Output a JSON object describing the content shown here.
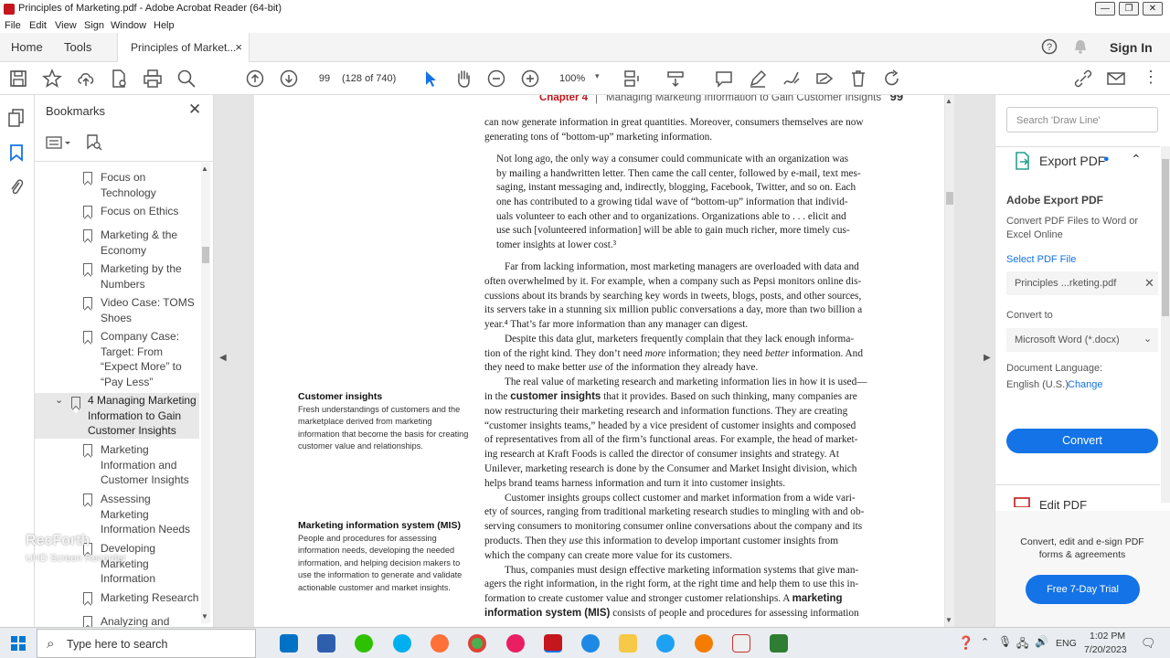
{
  "window": {
    "title": "Principles of Marketing.pdf - Adobe Acrobat Reader (64-bit)",
    "controls": [
      "—",
      "❐",
      "✕"
    ]
  },
  "menu": [
    "File",
    "Edit",
    "View",
    "Sign",
    "Window",
    "Help"
  ],
  "tabs": {
    "home": "Home",
    "tools": "Tools",
    "document": "Principles of Market...",
    "close": "×",
    "sign_in": "Sign In"
  },
  "toolbar": {
    "page_number": "99",
    "page_count": "(128 of 740)",
    "zoom": "100%"
  },
  "bookmarks": {
    "title": "Bookmarks",
    "items": [
      {
        "label": "Focus on Technology",
        "lines": [
          "Focus on",
          "Technology"
        ]
      },
      {
        "label": "Focus on Ethics",
        "lines": [
          "Focus on Ethics"
        ]
      },
      {
        "label": "Marketing & the Economy",
        "lines": [
          "Marketing & the",
          "Economy"
        ]
      },
      {
        "label": "Marketing by the Numbers",
        "lines": [
          "Marketing by the",
          "Numbers"
        ]
      },
      {
        "label": "Video Case: TOMS Shoes",
        "lines": [
          "Video Case: TOMS",
          "Shoes"
        ]
      },
      {
        "label": "Company Case: Target: From “Expect More” to “Pay Less”",
        "lines": [
          "Company Case:",
          "Target: From",
          "“Expect More” to",
          "“Pay Less”"
        ]
      }
    ],
    "chapter": {
      "lines": [
        "4 Managing Marketing",
        "Information to Gain",
        "Customer Insights"
      ]
    },
    "subitems": [
      {
        "lines": [
          "Marketing",
          "Information and",
          "Customer Insights"
        ]
      },
      {
        "lines": [
          "Assessing",
          "Marketing",
          "Information Needs"
        ]
      },
      {
        "lines": [
          "Developing",
          "Marketing",
          "Information"
        ]
      },
      {
        "lines": [
          "Marketing Research"
        ]
      },
      {
        "lines": [
          "Analyzing and"
        ]
      }
    ]
  },
  "page": {
    "header_chapter": "Chapter 4",
    "header_title": "Managing Marketing Information to Gain Customer Insights",
    "header_page": "99",
    "lines": [
      "can now generate information in great quantities. Moreover, consumers themselves are now",
      "generating tons of “bottom-up” marketing information.",
      "Not long ago, the only way a consumer could communicate with an organization was",
      "by mailing a handwritten letter. Then came the call center, followed by e-mail, text mes-",
      "saging, instant messaging and, indirectly, blogging, Facebook, Twitter, and so on. Each",
      "one has contributed to a growing tidal wave of “bottom-up” information that individ-",
      "uals volunteer to each other and to organizations. Organizations able to . . . elicit and",
      "use such [volunteered information] will be able to gain much richer, more timely cus-",
      "tomer insights at lower cost.³",
      "Far from lacking information, most marketing managers are overloaded with data and",
      "often overwhelmed by it. For example, when a company such as Pepsi monitors online dis-",
      "cussions about its brands by searching key words in tweets, blogs, posts, and other sources,",
      "its servers take in a stunning six million public conversations a day, more than two billion a",
      "year.⁴ That’s far more information than any manager can digest.",
      "Despite this data glut, marketers frequently complain that they lack enough informa-",
      "tion of the right kind. They don’t need more information; they need better information. And",
      "they need to make better use of the information they already have.",
      "The real value of marketing research and marketing information lies in how it is used—",
      "in the customer insights that it provides. Based on such thinking, many companies are",
      "now restructuring their marketing research and information functions. They are creating",
      "“customer insights teams,” headed by a vice president of customer insights and composed",
      "of representatives from all of the firm’s functional areas. For example, the head of market-",
      "ing research at Kraft Foods is called the director of consumer insights and strategy. At",
      "Unilever, marketing research is done by the Consumer and Market Insight division, which",
      "helps brand teams harness information and turn it into customer insights.",
      "Customer insights groups collect customer and market information from a wide vari-",
      "ety of sources, ranging from traditional marketing research studies to mingling with and ob-",
      "serving consumers to monitoring consumer online conversations about the company and its",
      "products. Then they use this information to develop important customer insights from",
      "which the company can create more value for its customers.",
      "Thus, companies must design effective marketing information systems that give man-",
      "agers the right information, in the right form, at the right time and help them to use this in-",
      "formation to create customer value and stronger customer relationships. A marketing",
      "information system (MIS) consists of people and procedures for assessing information"
    ],
    "sidebar1_title": "Customer insights",
    "sidebar1_text": "Fresh understandings of customers and the marketplace derived from marketing information that become the basis for creating customer value and relationships.",
    "sidebar2_title": "Marketing information system (MIS)",
    "sidebar2_text": "People and procedures for assessing information needs, developing the needed information, and helping decision makers to use the information to generate and validate actionable customer and market insights."
  },
  "right_panel": {
    "search_placeholder": "Search 'Draw Line'",
    "export_title": "Export PDF",
    "adobe_export": "Adobe Export PDF",
    "convert_desc": "Convert PDF Files to Word or Excel Online",
    "select_file": "Select PDF File",
    "file_name": "Principles ...rketing.pdf",
    "convert_to": "Convert to",
    "format": "Microsoft Word (*.docx)",
    "doc_language_label": "Document Language:",
    "doc_language": "English (U.S.)",
    "change": "Change",
    "convert_button": "Convert",
    "edit_pdf": "Edit PDF",
    "promo": "Convert, edit and e-sign PDF forms & agreements",
    "trial_button": "Free 7-Day Trial"
  },
  "taskbar": {
    "search_placeholder": "Type here to search",
    "lang": "ENG",
    "time": "1:02 PM",
    "date": "7/20/2023"
  },
  "watermark": {
    "line1": "RecForth",
    "line2": "UHD Screen Recorder"
  },
  "colors": {
    "accent": "#1473e6",
    "chapter_red": "#c4161c",
    "selected_bm": "#e8e8e8"
  }
}
